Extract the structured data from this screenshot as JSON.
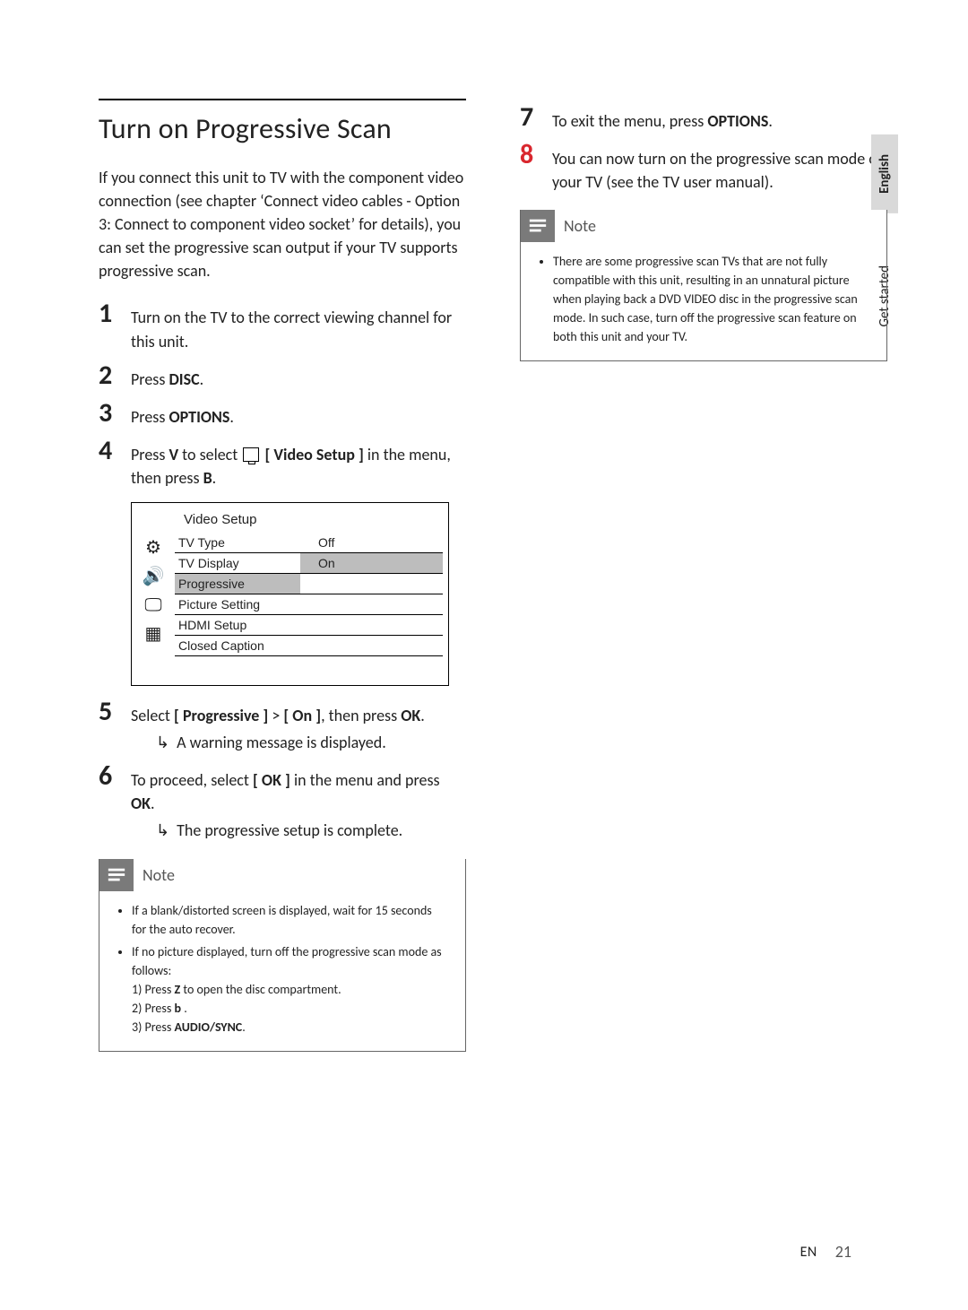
{
  "sideTabs": {
    "english": "English",
    "getStarted": "Get started"
  },
  "title": "Turn on Progressive Scan",
  "intro": "If you connect this unit to TV with the component video connection (see chapter ‘Connect video cables - Option 3: Connect to component video socket’ for details), you can set the progressive scan output if your TV supports progressive scan.",
  "steps": {
    "s1": "Turn on the TV to the correct viewing channel for this unit.",
    "s2_pre": "Press ",
    "s2_b": "DISC",
    "s2_post": ".",
    "s3_pre": "Press ",
    "s3_b": "OPTIONS",
    "s3_post": ".",
    "s4_pre": "Press ",
    "s4_b1": "V",
    "s4_mid": " to select ",
    "s4_b2": "[ Video Setup ]",
    "s4_post": " in the menu, then press ",
    "s4_b3": "B",
    "s4_end": ".",
    "s5_pre": "Select ",
    "s5_b1": "[ Progressive ]",
    "s5_mid": " > ",
    "s5_b2": "[ On ]",
    "s5_post": ", then press ",
    "s5_b3": "OK",
    "s5_end": ".",
    "s5_sub": "A warning message is displayed.",
    "s6_pre": "To proceed, select ",
    "s6_b1": "[ OK ]",
    "s6_mid": " in the menu and press ",
    "s6_b2": "OK",
    "s6_end": ".",
    "s6_sub": "The progressive setup is complete.",
    "s7_pre": "To exit the menu, press ",
    "s7_b": "OPTIONS",
    "s7_post": ".",
    "s8": "You can now turn on the progressive scan mode on your TV (see the TV user manual)."
  },
  "videoSetup": {
    "header": "Video Setup",
    "rows": [
      "TV Type",
      "TV Display",
      "Progressive",
      "Picture Setting",
      "HDMI Setup",
      "Closed Caption"
    ],
    "opt_off": "Off",
    "opt_on": "On"
  },
  "note1": {
    "label": "Note",
    "b1": "If a blank/distorted screen is displayed, wait for 15 seconds for the auto recover.",
    "b2": "If no picture displayed, turn off the progressive scan mode as follows:",
    "l1_pre": "1)  Press ",
    "l1_b": "Z",
    "l1_post": "  to open the disc compartment.",
    "l2_pre": "2)  Press ",
    "l2_b": "b",
    "l2_post": " .",
    "l3_pre": "3)  Press ",
    "l3_b": "AUDIO/SYNC",
    "l3_post": "."
  },
  "note2": {
    "label": "Note",
    "b1": "There are some progressive scan TVs that are not fully compatible with this unit, resulting in an unnatural picture when playing back a DVD VIDEO disc in the progressive scan mode. In such case, turn off the progressive scan feature on both this unit and your TV."
  },
  "footer": {
    "lang": "EN",
    "page": "21"
  }
}
